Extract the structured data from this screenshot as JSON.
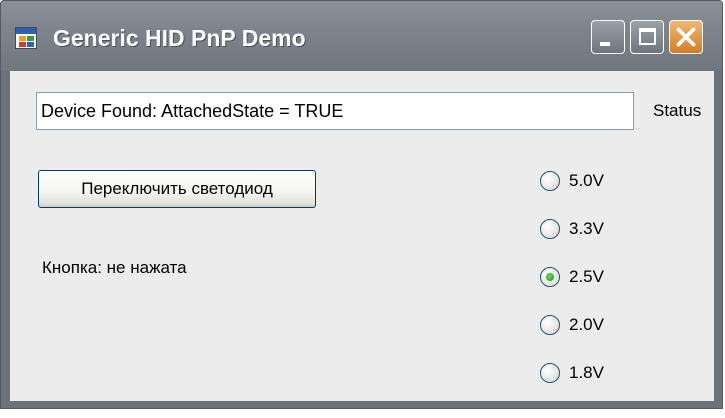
{
  "window": {
    "title": "Generic HID PnP Demo",
    "icon": "app-window-icon",
    "buttons": {
      "minimize": "minimize-icon",
      "maximize": "maximize-icon",
      "close": "close-icon"
    },
    "colors": {
      "titlebar": "#7c838b",
      "close_button": "#e08a34",
      "client_bg": "#ececec"
    }
  },
  "status": {
    "value": "Device Found: AttachedState = TRUE",
    "label": "Status"
  },
  "led_button": {
    "label": "Переключить светодиод"
  },
  "button_state": {
    "text": "Кнопка: не нажата"
  },
  "voltage": {
    "options": [
      "5.0V",
      "3.3V",
      "2.5V",
      "2.0V",
      "1.8V"
    ],
    "selected": "2.5V"
  }
}
